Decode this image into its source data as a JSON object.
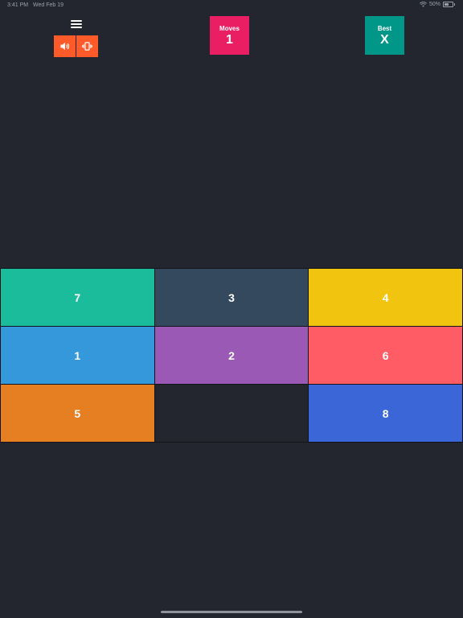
{
  "status_bar": {
    "time": "3:41 PM",
    "date": "Wed Feb 19",
    "battery_text": "50%",
    "battery_level": 0.5
  },
  "colors": {
    "background": "#23262e",
    "toggle_accent": "#ff5a29",
    "moves_box": "#e91e63",
    "best_box": "#009688"
  },
  "header": {
    "menu_icon": "hamburger-menu-icon",
    "sound_icon": "speaker-icon",
    "vibrate_icon": "vibrate-icon",
    "moves": {
      "label": "Moves",
      "value": "1"
    },
    "best": {
      "label": "Best",
      "value": "X"
    }
  },
  "board": {
    "rows": 3,
    "cols": 3,
    "tiles": [
      {
        "label": "7",
        "color": "#1abc9c"
      },
      {
        "label": "3",
        "color": "#34495e"
      },
      {
        "label": "4",
        "color": "#f1c40f"
      },
      {
        "label": "1",
        "color": "#3498db"
      },
      {
        "label": "2",
        "color": "#9b59b6"
      },
      {
        "label": "6",
        "color": "#ff5c66"
      },
      {
        "label": "5",
        "color": "#e67e22"
      },
      {
        "label": "",
        "color": "#23262e",
        "empty": true
      },
      {
        "label": "8",
        "color": "#3b66d8"
      }
    ]
  }
}
